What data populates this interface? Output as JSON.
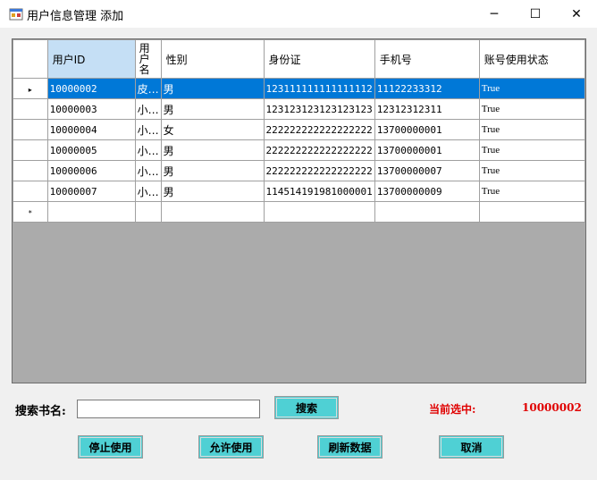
{
  "window": {
    "title": "用户信息管理 添加",
    "minimize_glyph": "─",
    "maximize_glyph": "☐",
    "close_glyph": "✕"
  },
  "grid": {
    "columns": [
      "用户ID",
      "用户名",
      "性别",
      "身份证",
      "手机号",
      "账号使用状态"
    ],
    "rows": [
      {
        "id": "10000002",
        "name": "皮…",
        "gender": "男",
        "idcard": "123111111111111112",
        "phone": "11122233312",
        "status": "True",
        "selected": true
      },
      {
        "id": "10000003",
        "name": "小…",
        "gender": "男",
        "idcard": "123123123123123123",
        "phone": "12312312311",
        "status": "True"
      },
      {
        "id": "10000004",
        "name": "小…",
        "gender": "女",
        "idcard": "222222222222222222",
        "phone": "13700000001",
        "status": "True"
      },
      {
        "id": "10000005",
        "name": "小…",
        "gender": "男",
        "idcard": "222222222222222222",
        "phone": "13700000001",
        "status": "True"
      },
      {
        "id": "10000006",
        "name": "小…",
        "gender": "男",
        "idcard": "222222222222222222",
        "phone": "13700000007",
        "status": "True"
      },
      {
        "id": "10000007",
        "name": "小…",
        "gender": "男",
        "idcard": "114514191981000001",
        "phone": "13700000009",
        "status": "True"
      }
    ],
    "current_row_glyph": "▸",
    "new_row_glyph": "*"
  },
  "search": {
    "label": "搜索书名:",
    "value": "",
    "button": "搜索"
  },
  "selection": {
    "label": "当前选中:",
    "value": "10000002"
  },
  "actions": {
    "disable": "停止使用",
    "enable": "允许使用",
    "refresh": "刷新数据",
    "cancel": "取消"
  },
  "colors": {
    "selected_row": "#0078d7",
    "button": "#4fd0d4",
    "selected_label": "#e00000"
  }
}
